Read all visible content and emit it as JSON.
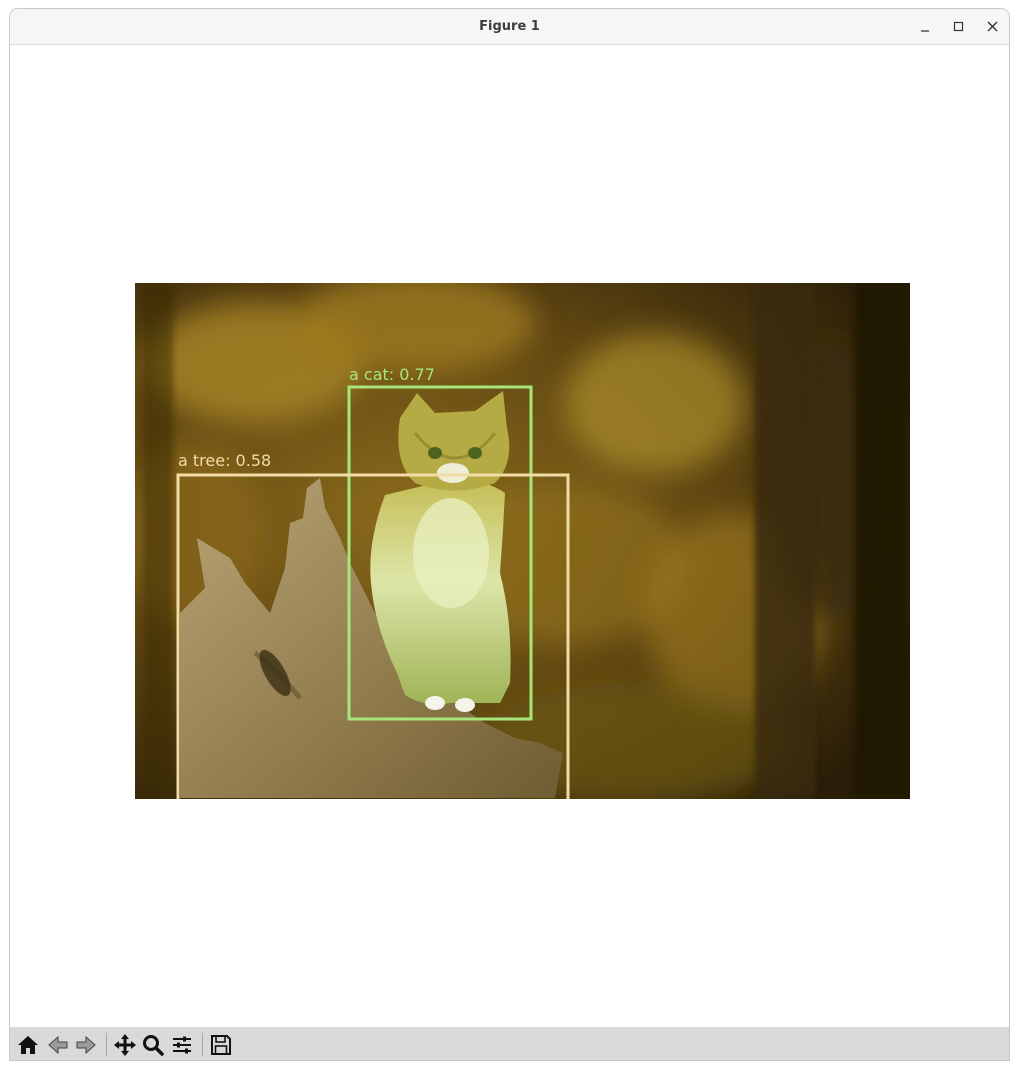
{
  "window": {
    "title": "Figure 1"
  },
  "detections": [
    {
      "label": "a cat: 0.77",
      "color": "#a6e67a"
    },
    {
      "label": "a tree: 0.58",
      "color": "#f2dca6"
    }
  ],
  "toolbar": {
    "tools": [
      "home-icon",
      "back-arrow-icon",
      "forward-arrow-icon",
      "pan-icon",
      "zoom-icon",
      "configure-subplots-icon",
      "save-icon"
    ]
  }
}
